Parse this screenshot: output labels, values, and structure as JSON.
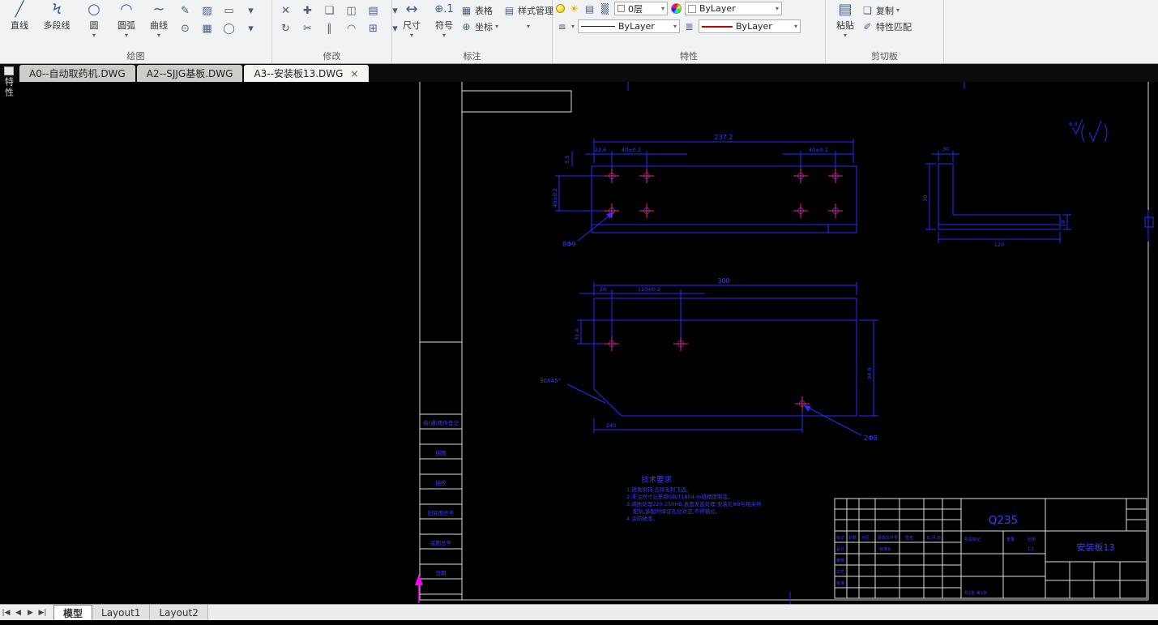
{
  "side_tool": {
    "label": "特性"
  },
  "icons": {
    "caret": "▾",
    "line": "╱",
    "polyline": "Ϟ",
    "circle": "○",
    "arc": "◠",
    "spline": "∼",
    "pencil": "✎",
    "hatch": "▨",
    "rect": "▭",
    "donut": "⊙",
    "grid": "▦",
    "ellipse": "◯",
    "erase": "✕",
    "move": "✚",
    "copy": "❏",
    "mirror": "◫",
    "array": "▤",
    "rotate": "↻",
    "trim": "✂",
    "offset": "∥",
    "fillet": "◠",
    "explode": "⊞",
    "dim": "↔",
    "symbol": "⊕.1",
    "table": "▦",
    "coord": "⊕",
    "style": "▤",
    "sun": "☀",
    "printer": "▤",
    "transparency": "▒",
    "lines": "≡",
    "lines2": "≣",
    "paste": "▤",
    "copydoc": "❏",
    "brush": "✐"
  },
  "ribbon": {
    "draw": {
      "label": "绘图",
      "line": "直线",
      "polyline": "多段线",
      "circle": "圆",
      "arc": "圆弧",
      "spline": "曲线"
    },
    "modify": {
      "label": "修改"
    },
    "annotate": {
      "label": "标注",
      "dim": "尺寸",
      "symbol": "符号",
      "table": "表格",
      "coord": "坐标",
      "style": "样式管理"
    },
    "properties": {
      "label": "特性",
      "layer": "0层",
      "color": "ByLayer",
      "linetype": "ByLayer",
      "lineweight": "ByLayer"
    },
    "clipboard": {
      "label": "剪切板",
      "paste": "粘贴",
      "copy": "复制",
      "match": "特性匹配"
    }
  },
  "doc_tabs": {
    "tabs": [
      {
        "label": "A0--自动取药机.DWG"
      },
      {
        "label": "A2--SJJG基板.DWG"
      },
      {
        "label": "A3--安装板13.DWG"
      }
    ],
    "close_glyph": "×"
  },
  "drawing": {
    "top": {
      "w": "237.2",
      "d1": "22.6",
      "d2": "40±0.2",
      "d3": "40±0.2",
      "d4": "5.5",
      "d5": "40±0.2",
      "holes": "8Φ9"
    },
    "side": {
      "a": "30",
      "b": "70",
      "c": "120",
      "d": "10"
    },
    "front": {
      "w": "300",
      "d1": "20",
      "d2": "120±0.2",
      "d3": "31.4",
      "d4": "94.9",
      "d5": "240",
      "chamfer": "30X45°",
      "holes": "2Φ9"
    },
    "roughness": "6.3",
    "notes": {
      "title": "技术要求",
      "lines": [
        "1.锐角倒钝,去除毛刺飞边。",
        "2.未注尺寸公差按GB/T1804-m级精度制造。",
        "3.调质处理220-250HB,表面发蓝处理,安装孔Φ9与相关件",
        "配钻,装配时保证孔位对正,不得错位。",
        "4.涂防锈漆。"
      ]
    },
    "title_block": {
      "material": "Q235",
      "part_name": "安装板13",
      "headers": [
        "标记",
        "处数",
        "分区",
        "更改文件号",
        "签名",
        "年.月.日"
      ],
      "roles": [
        "设计",
        "审核",
        "工艺",
        "批准"
      ],
      "extras": [
        "标准化",
        "阶段标记",
        "重量",
        "比例"
      ],
      "scale": "1:1",
      "sheet_no": "共1张 第1张"
    },
    "side_column": [
      "借(通)用件登记",
      "描图",
      "描校",
      "旧底图总号",
      "底图总号",
      "日期"
    ]
  },
  "layout_bar": {
    "nav": [
      "|◀",
      "◀",
      "▶",
      "▶|"
    ],
    "tabs": [
      "模型",
      "Layout1",
      "Layout2"
    ]
  }
}
